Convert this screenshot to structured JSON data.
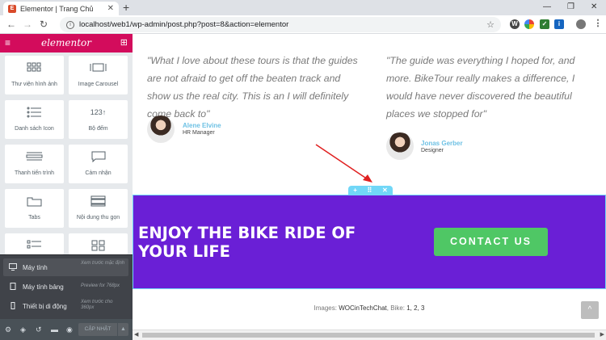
{
  "browser": {
    "tab_title": "Elementor | Trang Chủ",
    "url": "localhost/web1/wp-admin/post.php?post=8&action=elementor",
    "new_tab": "+",
    "minimize": "—",
    "restore": "❐",
    "close": "✕"
  },
  "panel": {
    "logo": "elementor",
    "widgets": [
      {
        "label": "Thư viện hình ảnh",
        "icon": "gallery-icon"
      },
      {
        "label": "Image Carousel",
        "icon": "carousel-icon"
      },
      {
        "label": "Danh sách Icon",
        "icon": "icon-list-icon"
      },
      {
        "label": "Bộ đếm",
        "icon": "counter-icon"
      },
      {
        "label": "Thanh tiến trình",
        "icon": "progress-bar-icon"
      },
      {
        "label": "Cảm nhận",
        "icon": "testimonial-icon"
      },
      {
        "label": "Tabs",
        "icon": "tabs-icon"
      },
      {
        "label": "Nội dung thu gọn",
        "icon": "accordion-icon"
      }
    ],
    "counter_glyph": "123",
    "devices": [
      {
        "name": "Máy tính",
        "hint": "Xem trước mặc định"
      },
      {
        "name": "Máy tính bảng",
        "hint": "Preview for 768px"
      },
      {
        "name": "Thiết bị di động",
        "hint": "Xem trước cho 360px"
      }
    ],
    "update_label": "CẬP NHẬT"
  },
  "preview": {
    "testimonials": [
      {
        "quote": "\"What I love about these tours is that the guides are not afraid to get off the beaten track and show us the real city. This is an I will definitely come back to\"",
        "name": "Alene Elvine",
        "role": "HR Manager"
      },
      {
        "quote": "\"The guide was everything I hoped for, and more. BikeTour really makes a difference, I would have never discovered the beautiful places we stopped for\"",
        "name": "Jonas Gerber",
        "role": "Designer"
      }
    ],
    "section_controls": {
      "add": "+",
      "move": "⠿",
      "delete": "✕"
    },
    "cta_title": "ENJOY THE BIKE RIDE OF YOUR LIFE",
    "cta_button": "CONTACT US",
    "credits_prefix": "Images: ",
    "credits_images": "WOCinTechChat",
    "credits_mid": ", Bike: ",
    "credits_bike": "1, 2, 3",
    "scroll_top": "^"
  },
  "colors": {
    "elementor_brand": "#d30c5c",
    "cta_background": "#6a1fd6",
    "cta_button": "#4fc765",
    "section_handle": "#71d7f7",
    "name_accent": "#6ec1e4"
  }
}
